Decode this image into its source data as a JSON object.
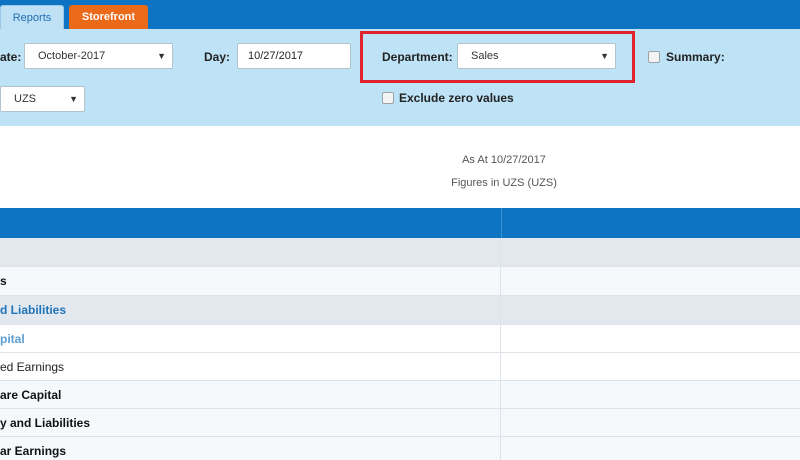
{
  "tabs": [
    {
      "label": "Reports"
    },
    {
      "label": "Storefront"
    }
  ],
  "filters": {
    "date_label": "ate:",
    "date_value": "October-2017",
    "day_label": "Day:",
    "day_value": "10/27/2017",
    "department_label": "Department:",
    "department_value": "Sales",
    "summary_label": "Summary:",
    "currency_value": "UZS",
    "exclude_zero_label": "Exclude zero values"
  },
  "report": {
    "as_at": "As At 10/27/2017",
    "figures_in": "Figures in UZS (UZS)"
  },
  "rows": [
    {
      "label": ""
    },
    {
      "label": "s"
    },
    {
      "label": "d Liabilities"
    },
    {
      "label": "pital"
    },
    {
      "label": "ed Earnings"
    },
    {
      "label": "are Capital"
    },
    {
      "label": "y and Liabilities"
    },
    {
      "label": "ar Earnings"
    }
  ],
  "colors": {
    "brand_blue": "#0d74c4",
    "filter_bg": "#bfe3f6",
    "storefront_orange": "#ea6a1a",
    "highlight_red": "#e0232f"
  }
}
